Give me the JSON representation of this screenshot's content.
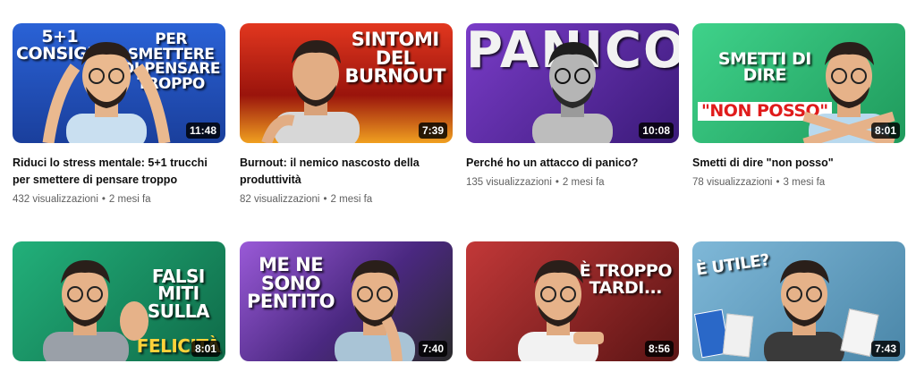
{
  "videos": [
    {
      "title": "Riduci lo stress mentale: 5+1 trucchi per smettere di pensare troppo",
      "views": "432 visualizzazioni",
      "age": "2 mesi fa",
      "duration": "11:48",
      "caption_left": "5+1\nCONSIGLI",
      "caption_right": "PER\nSMETTERE\nDI PENSARE\nTROPPO"
    },
    {
      "title": "Burnout: il nemico nascosto della produttività",
      "views": "82 visualizzazioni",
      "age": "2 mesi fa",
      "duration": "7:39",
      "caption": "SINTOMI\nDEL\nBURNOUT"
    },
    {
      "title": "Perché ho un attacco di panico?",
      "views": "135 visualizzazioni",
      "age": "2 mesi fa",
      "duration": "10:08",
      "caption": "PANICO"
    },
    {
      "title": "Smetti di dire \"non posso\"",
      "views": "78 visualizzazioni",
      "age": "3 mesi fa",
      "duration": "8:01",
      "caption": "SMETTI DI\nDIRE",
      "caption_highlight": "\"NON POSSO\""
    },
    {
      "duration": "8:01",
      "caption": "FALSI\nMITI\nSULLA",
      "caption_highlight": "FELICITÀ"
    },
    {
      "duration": "7:40",
      "caption": "ME NE\nSONO\nPENTITO"
    },
    {
      "duration": "8:56",
      "caption": "È TROPPO\nTARDI..."
    },
    {
      "duration": "7:43",
      "caption": "È UTILE?"
    }
  ],
  "colors": {
    "thumb1": "#1f4aa8",
    "thumb2": "#c8281e",
    "thumb3": "#5a2aa0",
    "thumb4": "#2bb870",
    "thumb5": "#1e9a6a",
    "thumb6": "#8c4cc7",
    "thumb7": "#b02a2a",
    "thumb8": "#6aa6c9",
    "meta_text": "#606060",
    "title_text": "#0f0f0f"
  }
}
